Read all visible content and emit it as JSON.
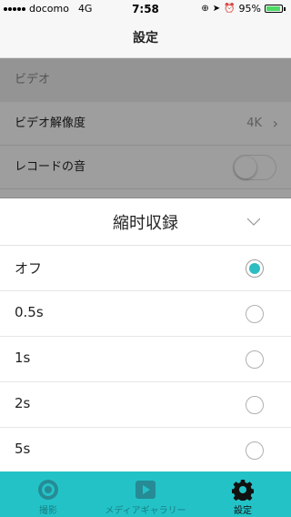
{
  "status": {
    "carrier": "docomo",
    "network": "4G",
    "time": "7:58",
    "battery": "95%",
    "battery_level": 0.95
  },
  "navbar": {
    "title": "設定"
  },
  "settings": {
    "section_header": "ビデオ",
    "resolution_label": "ビデオ解像度",
    "resolution_value": "4K",
    "record_sound_label": "レコードの音"
  },
  "sheet": {
    "title": "縮时収録",
    "options": [
      {
        "label": "オフ",
        "selected": true
      },
      {
        "label": "0.5s",
        "selected": false
      },
      {
        "label": "1s",
        "selected": false
      },
      {
        "label": "2s",
        "selected": false
      },
      {
        "label": "5s",
        "selected": false
      }
    ]
  },
  "tabbar": {
    "tabs": [
      {
        "label": "撮影",
        "icon": "camera-icon"
      },
      {
        "label": "メディアギャラリー",
        "icon": "play-icon"
      },
      {
        "label": "設定",
        "icon": "gear-icon"
      }
    ],
    "accent": "#23c2c7"
  },
  "colors": {
    "radio_selected": "#2ebdc0"
  }
}
